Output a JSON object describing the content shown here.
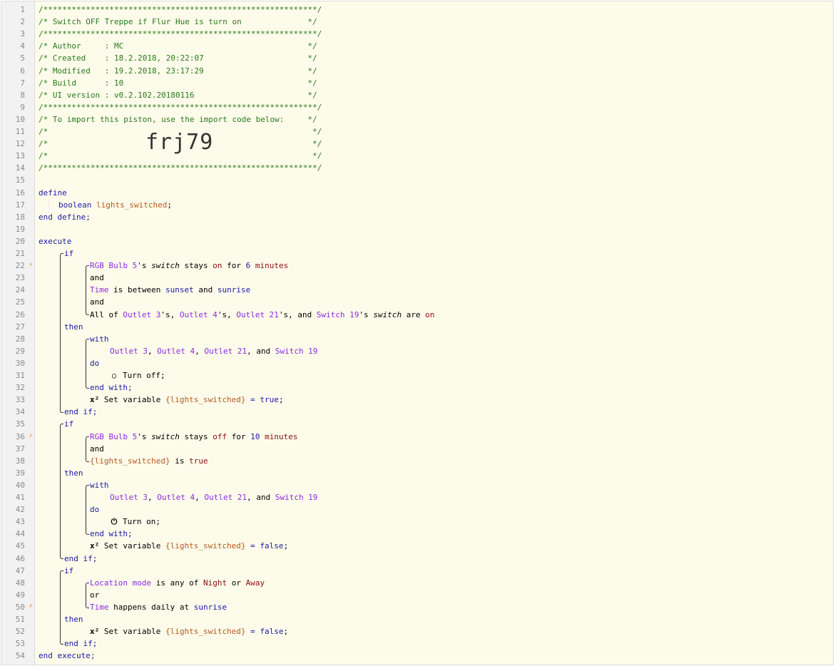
{
  "piston": {
    "header": [
      "/**********************************************************/",
      "/* Switch OFF Treppe if Flur Hue is turn on              */",
      "/**********************************************************/",
      "/* Author     : MC                                       */",
      "/* Created    : 18.2.2018, 20:22:07                      */",
      "/* Modified   : 19.2.2018, 23:17:29                      */",
      "/* Build      : 10                                       */",
      "/* UI version : v0.2.102.20180116                        */",
      "/**********************************************************/",
      "/* To import this piston, use the import code below:     */",
      "/*                                                        */",
      "/*                                                        */",
      "/*                                                        */",
      "/**********************************************************/"
    ],
    "import_code": "frj79",
    "line_numbers": [
      "1",
      "2",
      "3",
      "4",
      "5",
      "6",
      "7",
      "8",
      "9",
      "10",
      "11",
      "12",
      "13",
      "14",
      "15",
      "16",
      "17",
      "18",
      "19",
      "20",
      "21",
      "22",
      "23",
      "24",
      "25",
      "26",
      "27",
      "28",
      "29",
      "30",
      "31",
      "32",
      "33",
      "34",
      "35",
      "36",
      "37",
      "38",
      "39",
      "40",
      "41",
      "42",
      "43",
      "44",
      "45",
      "46",
      "47",
      "48",
      "49",
      "50",
      "51",
      "52",
      "53",
      "54"
    ],
    "trigger_icon": "lightning-icon",
    "kw": {
      "define": "define",
      "boolean": "boolean",
      "var_decl": "lights_switched",
      "end_define": "end define;",
      "execute": "execute",
      "if": "if",
      "then": "then",
      "with": "with",
      "do": "do",
      "end_with": "end with;",
      "end_if": "end if;",
      "and": "and",
      "or": "or",
      "end_execute": "end execute;"
    },
    "block1": {
      "c1_dev": "RGB Bulb 5",
      "c1_s": "'s ",
      "c1_attr": "switch",
      "c1_stays": " stays ",
      "c1_val": "on",
      "c1_for": " for ",
      "c1_num": "6",
      "c1_unit": " minutes",
      "c2_dev": "Time",
      "c2_txt": " is between ",
      "c2_a": "sunset",
      "c2_and": " and ",
      "c2_b": "sunrise",
      "c3_pre": "All of ",
      "c3_d1": "Outlet 3",
      "c3_s1": "'s, ",
      "c3_d2": "Outlet 4",
      "c3_s2": "'s, ",
      "c3_d3": "Outlet 21",
      "c3_s3": "'s, and ",
      "c3_d4": "Switch 19",
      "c3_s4": "'s ",
      "c3_attr": "switch",
      "c3_are": " are ",
      "c3_val": "on",
      "with_d1": "Outlet 3",
      "with_d2": "Outlet 4",
      "with_d3": "Outlet 21",
      "with_d4": "Switch 19",
      "comma": ", ",
      "and_sep": ", and ",
      "action": "Turn off;",
      "action_icon": "power-off-icon",
      "set_label": "Set variable ",
      "set_var": "{lights_switched}",
      "set_eq": " = ",
      "set_val": "true",
      "semi": ";"
    },
    "block2": {
      "c1_dev": "RGB Bulb 5",
      "c1_s": "'s ",
      "c1_attr": "switch",
      "c1_stays": " stays ",
      "c1_val": "off",
      "c1_for": " for ",
      "c1_num": "10",
      "c1_unit": " minutes",
      "c2_var": "{lights_switched}",
      "c2_is": " is ",
      "c2_val": "true",
      "with_d1": "Outlet 3",
      "with_d2": "Outlet 4",
      "with_d3": "Outlet 21",
      "with_d4": "Switch 19",
      "comma": ", ",
      "and_sep": ", and ",
      "action": "Turn on;",
      "action_icon": "power-on-icon",
      "set_label": "Set variable ",
      "set_var": "{lights_switched}",
      "set_eq": " = ",
      "set_val": "false",
      "semi": ";"
    },
    "block3": {
      "c1_dev": "Location mode",
      "c1_txt": " is any of ",
      "c1_a": "Night",
      "c1_or": " or ",
      "c1_b": "Away",
      "c2_dev": "Time",
      "c2_txt": " happens daily at ",
      "c2_val": "sunrise",
      "set_label": "Set variable ",
      "set_var": "{lights_switched}",
      "set_eq": " = ",
      "set_val": "false",
      "semi": ";"
    },
    "set_icon": "x2-icon",
    "set_icon_text": "x²"
  }
}
